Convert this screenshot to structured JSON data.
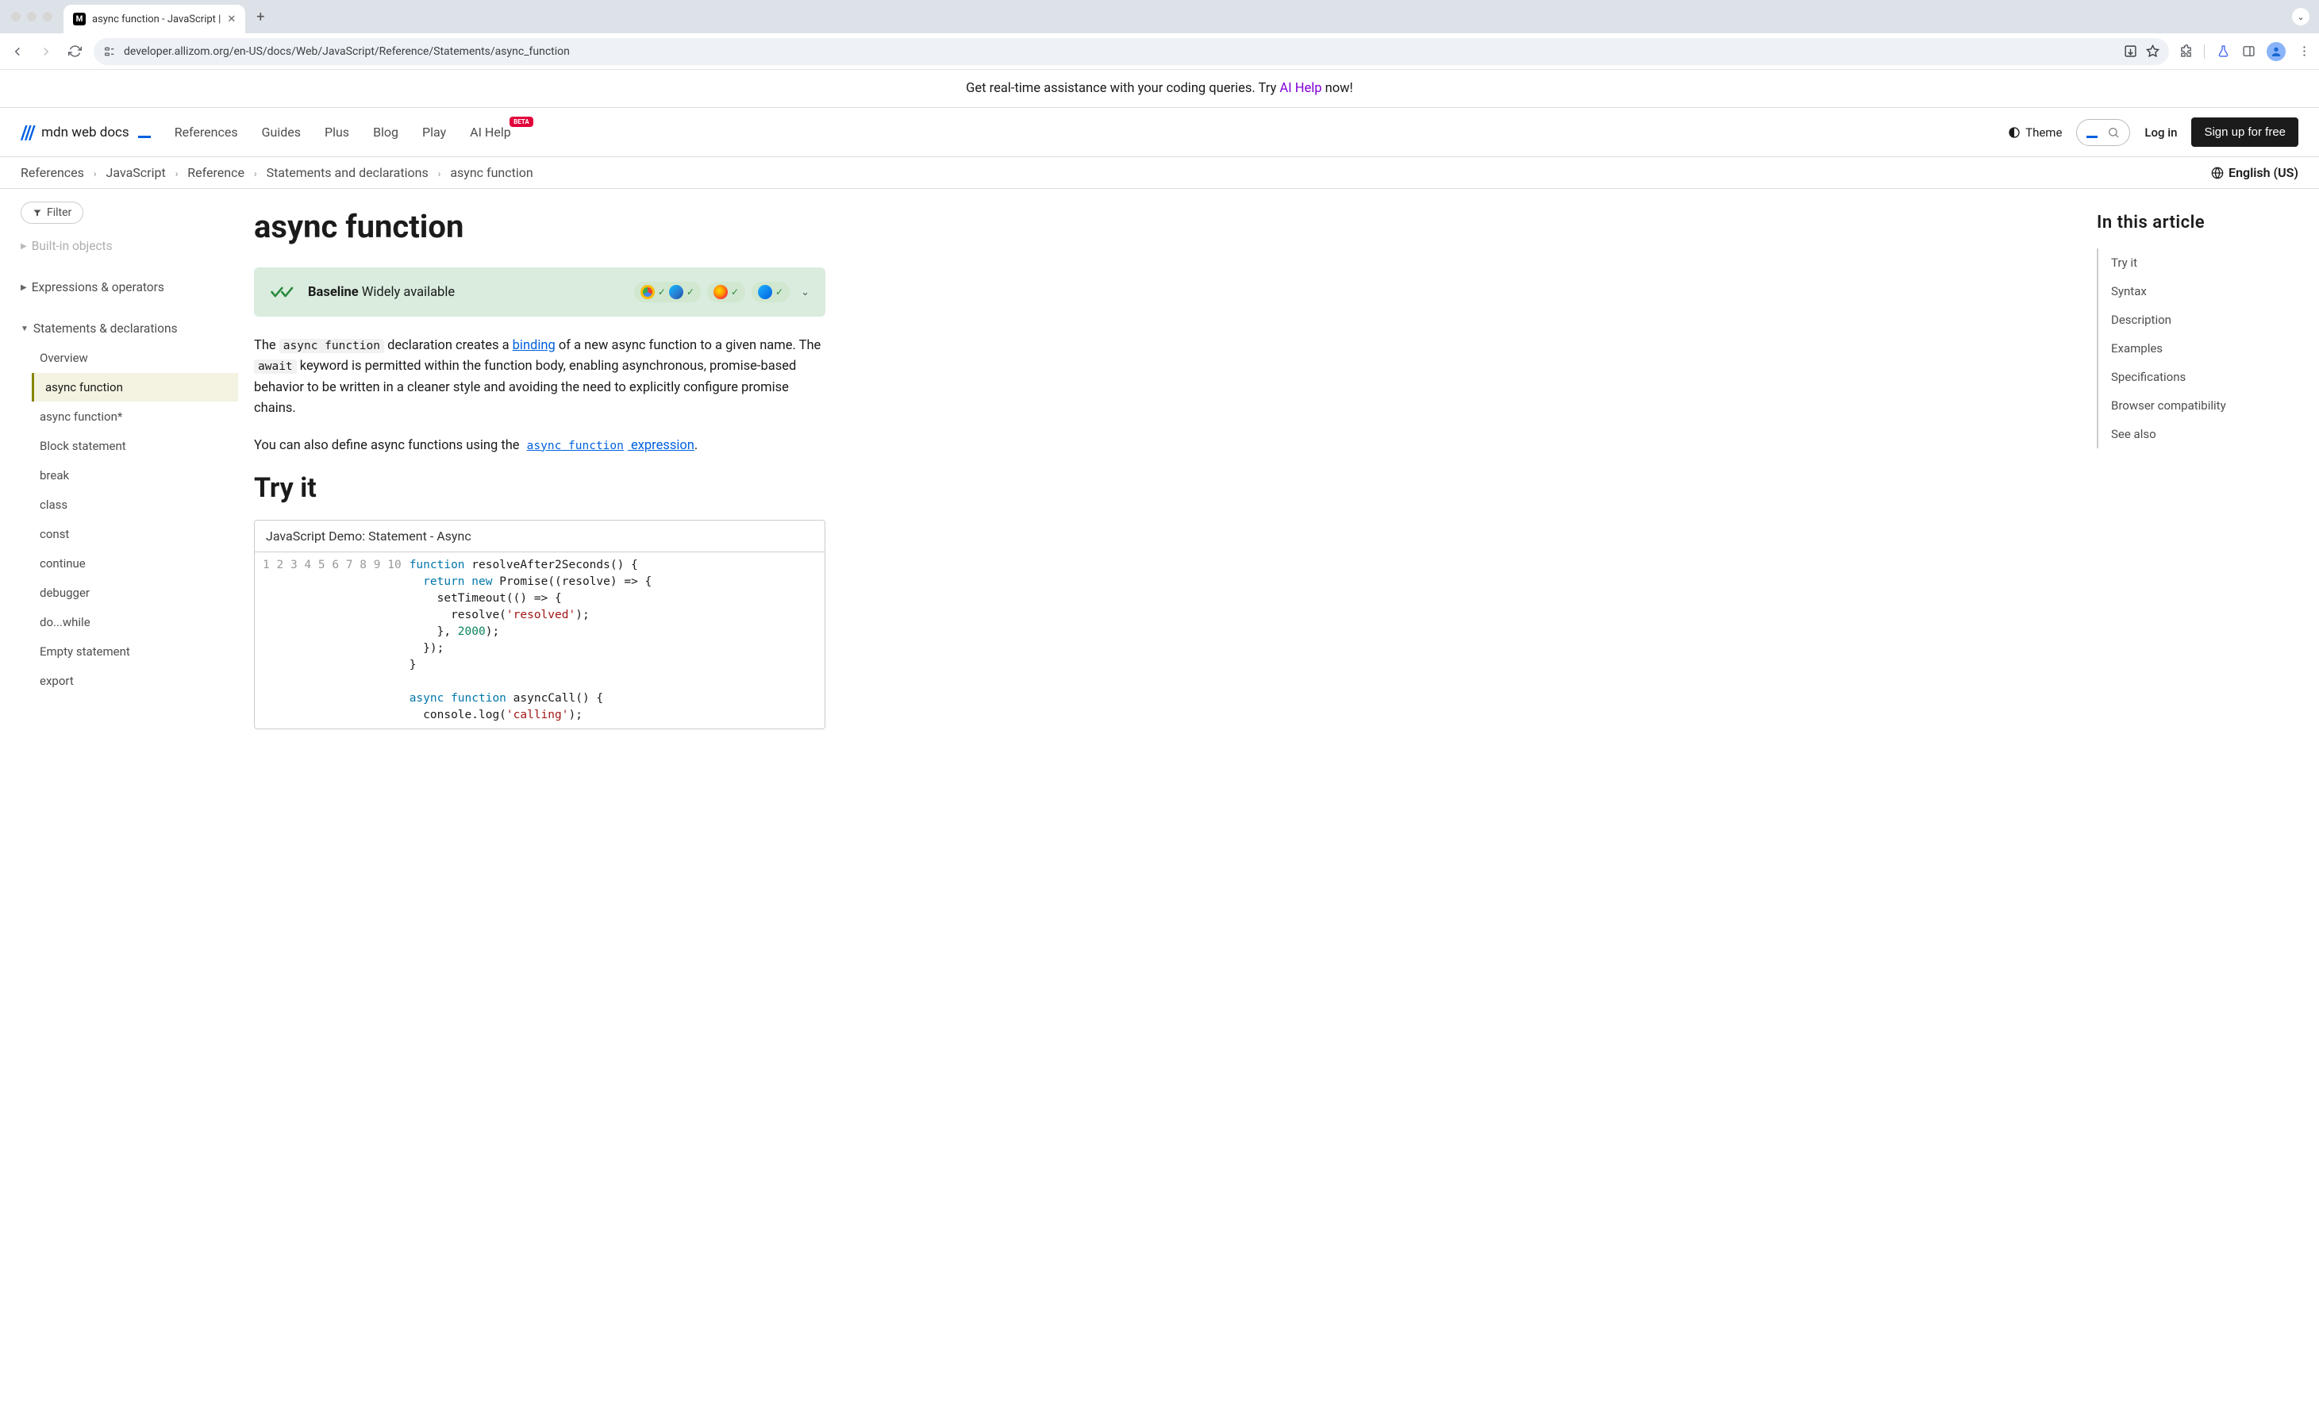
{
  "browser": {
    "tab_title": "async function - JavaScript |",
    "url": "developer.allizom.org/en-US/docs/Web/JavaScript/Reference/Statements/async_function"
  },
  "banner": {
    "prefix": "Get real-time assistance with your coding queries. Try ",
    "link": "AI Help",
    "suffix": " now!"
  },
  "header": {
    "logo": "mdn web docs",
    "nav": [
      "References",
      "Guides",
      "Plus",
      "Blog",
      "Play",
      "AI Help"
    ],
    "ai_badge": "BETA",
    "theme": "Theme",
    "login": "Log in",
    "signup": "Sign up for free"
  },
  "breadcrumbs": [
    "References",
    "JavaScript",
    "Reference",
    "Statements and declarations",
    "async function"
  ],
  "language": "English (US)",
  "sidebar": {
    "filter_placeholder": "Filter",
    "group_faded": "Built-in objects",
    "group_expr": "Expressions & operators",
    "group_stmt": "Statements & declarations",
    "items": [
      "Overview",
      "async function",
      "async function*",
      "Block statement",
      "break",
      "class",
      "const",
      "continue",
      "debugger",
      "do...while",
      "Empty statement",
      "export"
    ],
    "active_index": 1
  },
  "content": {
    "title": "async function",
    "baseline_bold": "Baseline",
    "baseline_rest": " Widely available",
    "para1_pre": "The ",
    "para1_code1": "async function",
    "para1_mid1": " declaration creates a ",
    "para1_link1": "binding",
    "para1_mid2": " of a new async function to a given name. The ",
    "para1_code2": "await",
    "para1_post": " keyword is permitted within the function body, enabling asynchronous, promise-based behavior to be written in a cleaner style and avoiding the need to explicitly configure promise chains.",
    "para2_pre": "You can also define async functions using the ",
    "para2_linkcode": "async function",
    "para2_linktext": " expression",
    "para2_post": ".",
    "tryit_title": "Try it",
    "demo_header": "JavaScript Demo: Statement - Async",
    "code_lines": [
      [
        {
          "t": "function",
          "c": "kw"
        },
        {
          "t": " resolveAfter2Seconds() {"
        }
      ],
      [
        {
          "t": "  "
        },
        {
          "t": "return",
          "c": "kw"
        },
        {
          "t": " "
        },
        {
          "t": "new",
          "c": "kw"
        },
        {
          "t": " Promise((resolve) => {"
        }
      ],
      [
        {
          "t": "    setTimeout(() => {"
        }
      ],
      [
        {
          "t": "      resolve("
        },
        {
          "t": "'resolved'",
          "c": "str"
        },
        {
          "t": ");"
        }
      ],
      [
        {
          "t": "    }, "
        },
        {
          "t": "2000",
          "c": "num"
        },
        {
          "t": ");"
        }
      ],
      [
        {
          "t": "  });"
        }
      ],
      [
        {
          "t": "}"
        }
      ],
      [
        {
          "t": ""
        }
      ],
      [
        {
          "t": "async",
          "c": "kw"
        },
        {
          "t": " "
        },
        {
          "t": "function",
          "c": "kw"
        },
        {
          "t": " asyncCall() {"
        }
      ],
      [
        {
          "t": "  console.log("
        },
        {
          "t": "'calling'",
          "c": "str"
        },
        {
          "t": ");"
        }
      ]
    ]
  },
  "toc": {
    "title": "In this article",
    "items": [
      "Try it",
      "Syntax",
      "Description",
      "Examples",
      "Specifications",
      "Browser compatibility",
      "See also"
    ]
  }
}
